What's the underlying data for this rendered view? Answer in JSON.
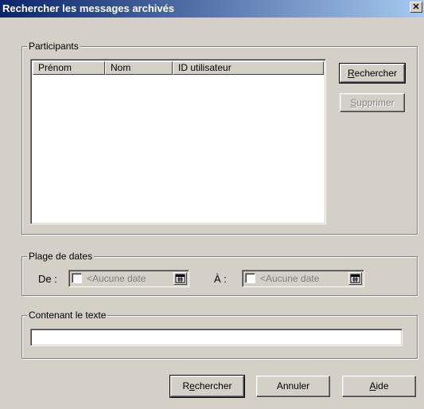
{
  "window": {
    "title": "Rechercher les messages archivés",
    "close_glyph": "✕"
  },
  "participants": {
    "legend": "Participants",
    "columns": [
      "Prénom",
      "Nom",
      "ID utilisateur"
    ],
    "search_button": {
      "mnemonic": "R",
      "rest": "echercher"
    },
    "delete_button": {
      "mnemonic": "S",
      "rest": "upprimer"
    }
  },
  "dates": {
    "legend": "Plage de dates",
    "from_label": "De :",
    "to_label": "À :",
    "from_value": "<Aucune date",
    "to_value": "<Aucune date"
  },
  "text": {
    "legend": "Contenant le texte",
    "value": ""
  },
  "footer": {
    "search_button": {
      "pre": "R",
      "mnemonic": "e",
      "rest": "chercher"
    },
    "cancel_label": "Annuler",
    "help_button": {
      "mnemonic": "A",
      "rest": "ide"
    }
  },
  "icons": {
    "calendar": "calendar-icon",
    "checkbox": "checkbox"
  }
}
